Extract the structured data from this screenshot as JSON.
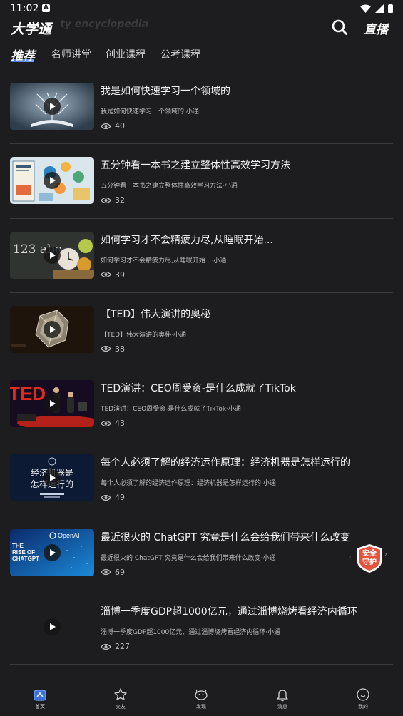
{
  "status_bar": {
    "time": "11:02",
    "notif_letter": "A"
  },
  "app_bar": {
    "title": "大学通",
    "watermark": "ty encyclopedia",
    "live_label": "直播"
  },
  "tabs": [
    {
      "label": "推荐",
      "active": true
    },
    {
      "label": "名师讲堂",
      "active": false
    },
    {
      "label": "创业课程",
      "active": false
    },
    {
      "label": "公考课程",
      "active": false
    }
  ],
  "videos": [
    {
      "title": "我是如何快速学习一个领域的",
      "subtitle": "我是如何快速学习一个领域的·小通",
      "views": "40"
    },
    {
      "title": "五分钟看一本书之建立整体性高效学习方法",
      "subtitle": "五分钟看一本书之建立整体性高效学习方法·小通",
      "views": "32"
    },
    {
      "title": "如何学习才不会精疲力尽,从睡眠开始...",
      "subtitle": "如何学习才不会精疲力尽,从睡眠开始...·小通",
      "views": "39"
    },
    {
      "title": "【TED】伟大演讲的奥秘",
      "subtitle": "【TED】伟大演讲的奥秘·小通",
      "views": "38"
    },
    {
      "title": "TED演讲：CEO周受资-是什么成就了TikTok",
      "subtitle": "TED演讲：CEO周受资-是什么成就了TikTok·小通",
      "views": "43"
    },
    {
      "title": "每个人必须了解的经济运作原理：经济机器是怎样运行的",
      "subtitle": "每个人必须了解的经济运作原理：经济机器是怎样运行的·小通",
      "views": "49"
    },
    {
      "title": "最近很火的 ChatGPT 究竟是什么会给我们带来什么改变",
      "subtitle": "最近很火的 ChatGPT 究竟是什么会给我们带来什么改变·小通",
      "views": "69"
    },
    {
      "title": "淄博一季度GDP超1000亿元，通过淄博烧烤看经济内循环",
      "subtitle": "淄博一季度GDP超1000亿元，通过淄博烧烤看经济内循环·小通",
      "views": "227"
    }
  ],
  "thumbnails": {
    "t3_text": "123 abc",
    "t4_ted": "TED",
    "t6_lines": [
      "经济机器是",
      "怎样运行的"
    ],
    "t7_logo": "OpenAI",
    "t7_lines": [
      "THE",
      "RISE OF",
      "CHATGPT"
    ]
  },
  "badge": {
    "line1": "安全",
    "line2": "守护",
    "arrow_left": "‹",
    "arrow_right": "›"
  },
  "bottom_nav": [
    {
      "label": "首页",
      "icon": "home-icon",
      "active": true
    },
    {
      "label": "交友",
      "icon": "star-icon",
      "active": false
    },
    {
      "label": "发现",
      "icon": "discover-icon",
      "active": false
    },
    {
      "label": "消息",
      "icon": "bell-icon",
      "active": false
    },
    {
      "label": "我的",
      "icon": "profile-icon",
      "active": false
    }
  ],
  "colors": {
    "background": "#1d1d1f",
    "accent": "#3b6fd9",
    "badge": "#e5533c"
  }
}
